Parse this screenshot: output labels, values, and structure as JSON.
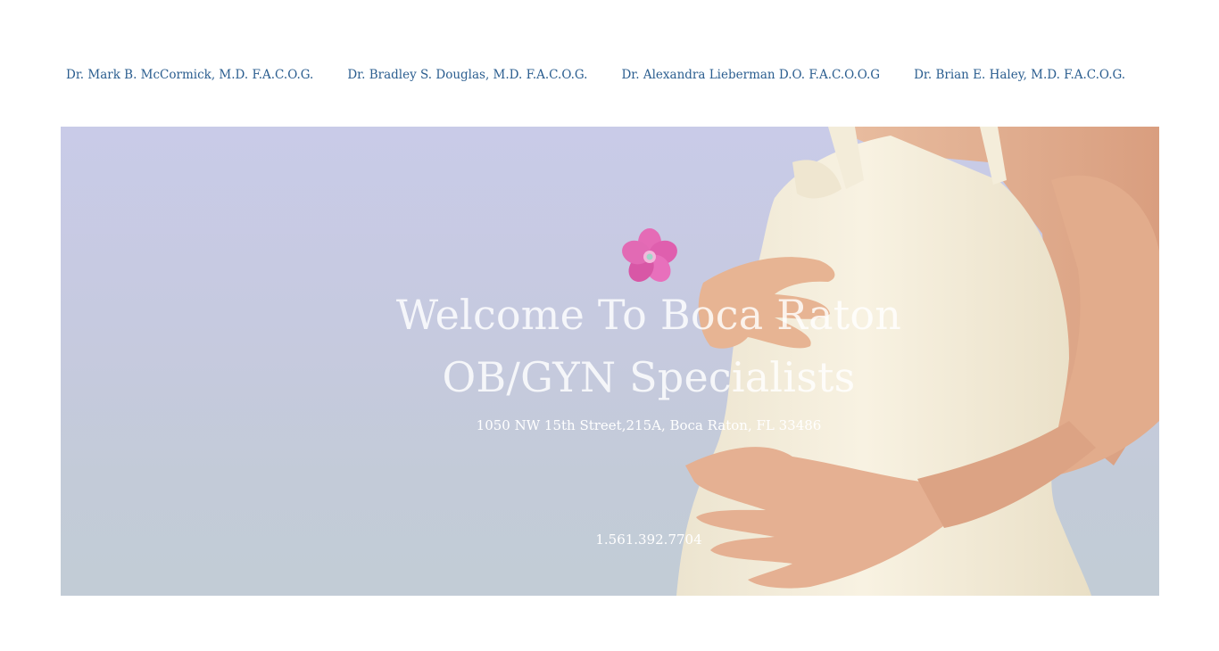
{
  "nav": {
    "links": [
      "Dr. Mark B. McCormick, M.D. F.A.C.O.G.",
      "Dr. Bradley S. Douglas, M.D. F.A.C.O.G.",
      "Dr. Alexandra Lieberman D.O. F.A.C.O.O.G",
      "Dr. Brian E. Haley, M.D. F.A.C.O.G."
    ]
  },
  "hero": {
    "title_line1": "Welcome To Boca Raton",
    "title_line2": "OB/GYN Specialists",
    "address": "1050 NW 15th Street,215A, Boca Raton, FL 33486",
    "phone": "1.561.392.7704",
    "flower_icon": "pink-flower-icon",
    "colors": {
      "sky": "#c9cbe8",
      "dress": "#f6efdc",
      "skin": "#e8b99a",
      "flower": "#e66bb8",
      "nav_link": "#2a5d8f"
    }
  }
}
